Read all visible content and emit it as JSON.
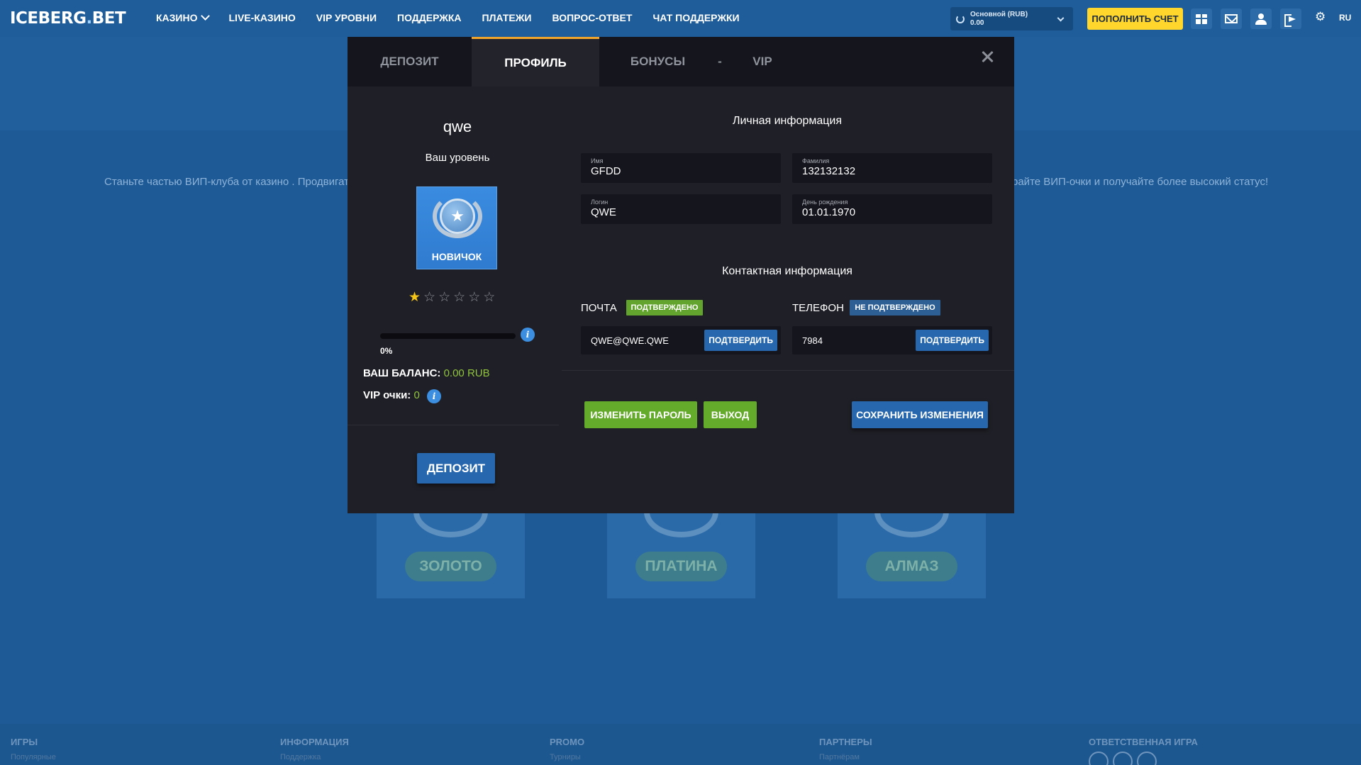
{
  "header": {
    "logo_main": "ICEBERG",
    "logo_dot": ".",
    "logo_tail": "BET",
    "nav": [
      {
        "label": "КАЗИНО"
      },
      {
        "label": "LIVE-КАЗИНО"
      },
      {
        "label": "VIP УРОВНИ"
      },
      {
        "label": "ПОДДЕРЖКА"
      },
      {
        "label": "ПЛАТЕЖИ"
      },
      {
        "label": "ВОПРОС-ОТВЕТ"
      },
      {
        "label": "ЧАТ ПОДДЕРЖКИ"
      }
    ],
    "balance_account": "Основной (RUB)",
    "balance_amount": "0.00",
    "topup_label": "ПОПОЛНИТЬ СЧЕТ",
    "gear_glyph": "⚙",
    "lang": "RU"
  },
  "background": {
    "promo_left": "Станьте частью ВИП-клуба от казино . Продвигатесь",
    "promo_right": "райте ВИП-очки и получайте более высокий статус!",
    "levels": [
      {
        "label": "ЗОЛОТО"
      },
      {
        "label": "ПЛАТИНА"
      },
      {
        "label": "АЛМАЗ"
      }
    ]
  },
  "footer": {
    "columns": [
      {
        "head": "ИГРЫ",
        "sub": "Популярные"
      },
      {
        "head": "ИНФОРМАЦИЯ",
        "sub": "Поддержка"
      },
      {
        "head": "PROMO",
        "sub": "Турниры"
      },
      {
        "head": "ПАРТНЕРЫ",
        "sub": "Партнёрам"
      },
      {
        "head": "ОТВЕТСТВЕННАЯ ИГРА",
        "sub": ""
      }
    ]
  },
  "modal": {
    "tabs": [
      {
        "label": "ДЕПОЗИТ"
      },
      {
        "label": "ПРОФИЛЬ"
      },
      {
        "label": "БОНУСЫ"
      },
      {
        "label": "-"
      },
      {
        "label": "VIP"
      }
    ],
    "active_tab": 1,
    "profile": {
      "username": "qwe",
      "your_level": "Ваш уровень",
      "level_name": "НОВИЧОК",
      "stars_total": 6,
      "stars_filled": 1,
      "progress_fraction": 0.0,
      "progress_label": "0%",
      "balance_label": "ВАШ БАЛАНС:",
      "balance_value": "0.00 RUB",
      "vip_label": "VIP очки:",
      "vip_value": "0",
      "deposit_button": "ДЕПОЗИТ"
    },
    "personal": {
      "title": "Личная информация",
      "first_name_label": "Имя",
      "first_name_value": "GFDD",
      "last_name_label": "Фамилия",
      "last_name_value": "132132132",
      "login_label": "Логин",
      "login_value": "QWE",
      "birthday_label": "День рождения",
      "birthday_value": "01.01.1970"
    },
    "contact": {
      "title": "Контактная информация",
      "email_label": "ПОЧТА",
      "email_status": "ПОДТВЕРЖДЕНО",
      "email_value": "QWE@QWE.QWE",
      "email_confirm": "ПОДТВЕРДИТЬ",
      "phone_label": "ТЕЛЕФОН",
      "phone_status": "НЕ ПОДТВЕРЖДЕНО",
      "phone_value": "7984",
      "phone_confirm": "ПОДТВЕРДИТЬ"
    },
    "actions": {
      "change_password": "ИЗМЕНИТЬ ПАРОЛЬ",
      "logout": "ВЫХОД",
      "save": "СОХРАНИТЬ ИЗМЕНЕНИЯ"
    },
    "colors": {
      "accent_blue": "#2767ad",
      "accent_green": "#64aa2b",
      "active_tab_border": "#f1a52a",
      "star_filled": "#f5c518"
    }
  }
}
